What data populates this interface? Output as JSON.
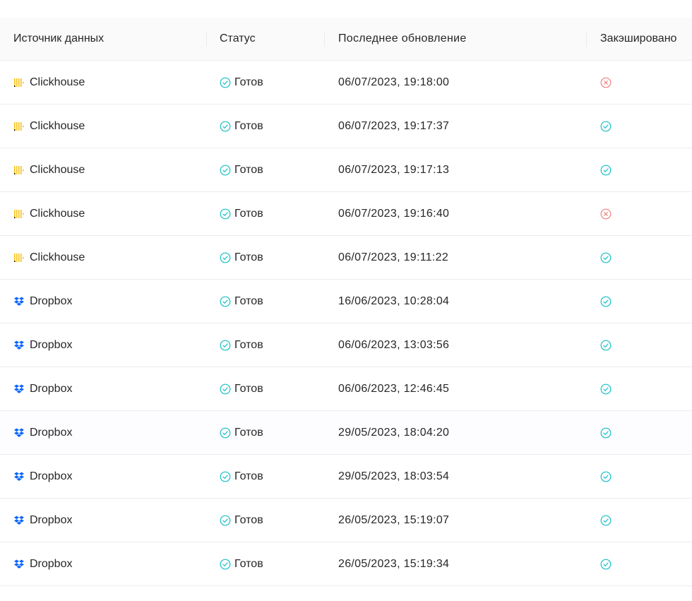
{
  "columns": {
    "source": "Источник данных",
    "status": "Статус",
    "updated": "Последнее обновление",
    "cached": "Закэшировано"
  },
  "colors": {
    "clickhouse": "#f7c31c",
    "dropbox": "#0a65fe",
    "success": "#17c0c8",
    "error": "#f08080"
  },
  "rows": [
    {
      "source": "Clickhouse",
      "source_icon": "clickhouse-icon",
      "status": "Готов",
      "updated": "06/07/2023, 19:18:00",
      "cached": false
    },
    {
      "source": "Clickhouse",
      "source_icon": "clickhouse-icon",
      "status": "Готов",
      "updated": "06/07/2023, 19:17:37",
      "cached": true
    },
    {
      "source": "Clickhouse",
      "source_icon": "clickhouse-icon",
      "status": "Готов",
      "updated": "06/07/2023, 19:17:13",
      "cached": true
    },
    {
      "source": "Clickhouse",
      "source_icon": "clickhouse-icon",
      "status": "Готов",
      "updated": "06/07/2023, 19:16:40",
      "cached": false
    },
    {
      "source": "Clickhouse",
      "source_icon": "clickhouse-icon",
      "status": "Готов",
      "updated": "06/07/2023, 19:11:22",
      "cached": true
    },
    {
      "source": "Dropbox",
      "source_icon": "dropbox-icon",
      "status": "Готов",
      "updated": "16/06/2023, 10:28:04",
      "cached": true
    },
    {
      "source": "Dropbox",
      "source_icon": "dropbox-icon",
      "status": "Готов",
      "updated": "06/06/2023, 13:03:56",
      "cached": true
    },
    {
      "source": "Dropbox",
      "source_icon": "dropbox-icon",
      "status": "Готов",
      "updated": "06/06/2023, 12:46:45",
      "cached": true
    },
    {
      "source": "Dropbox",
      "source_icon": "dropbox-icon",
      "status": "Готов",
      "updated": "29/05/2023, 18:04:20",
      "cached": true
    },
    {
      "source": "Dropbox",
      "source_icon": "dropbox-icon",
      "status": "Готов",
      "updated": "29/05/2023, 18:03:54",
      "cached": true
    },
    {
      "source": "Dropbox",
      "source_icon": "dropbox-icon",
      "status": "Готов",
      "updated": "26/05/2023, 15:19:07",
      "cached": true
    },
    {
      "source": "Dropbox",
      "source_icon": "dropbox-icon",
      "status": "Готов",
      "updated": "26/05/2023, 15:19:34",
      "cached": true
    }
  ]
}
